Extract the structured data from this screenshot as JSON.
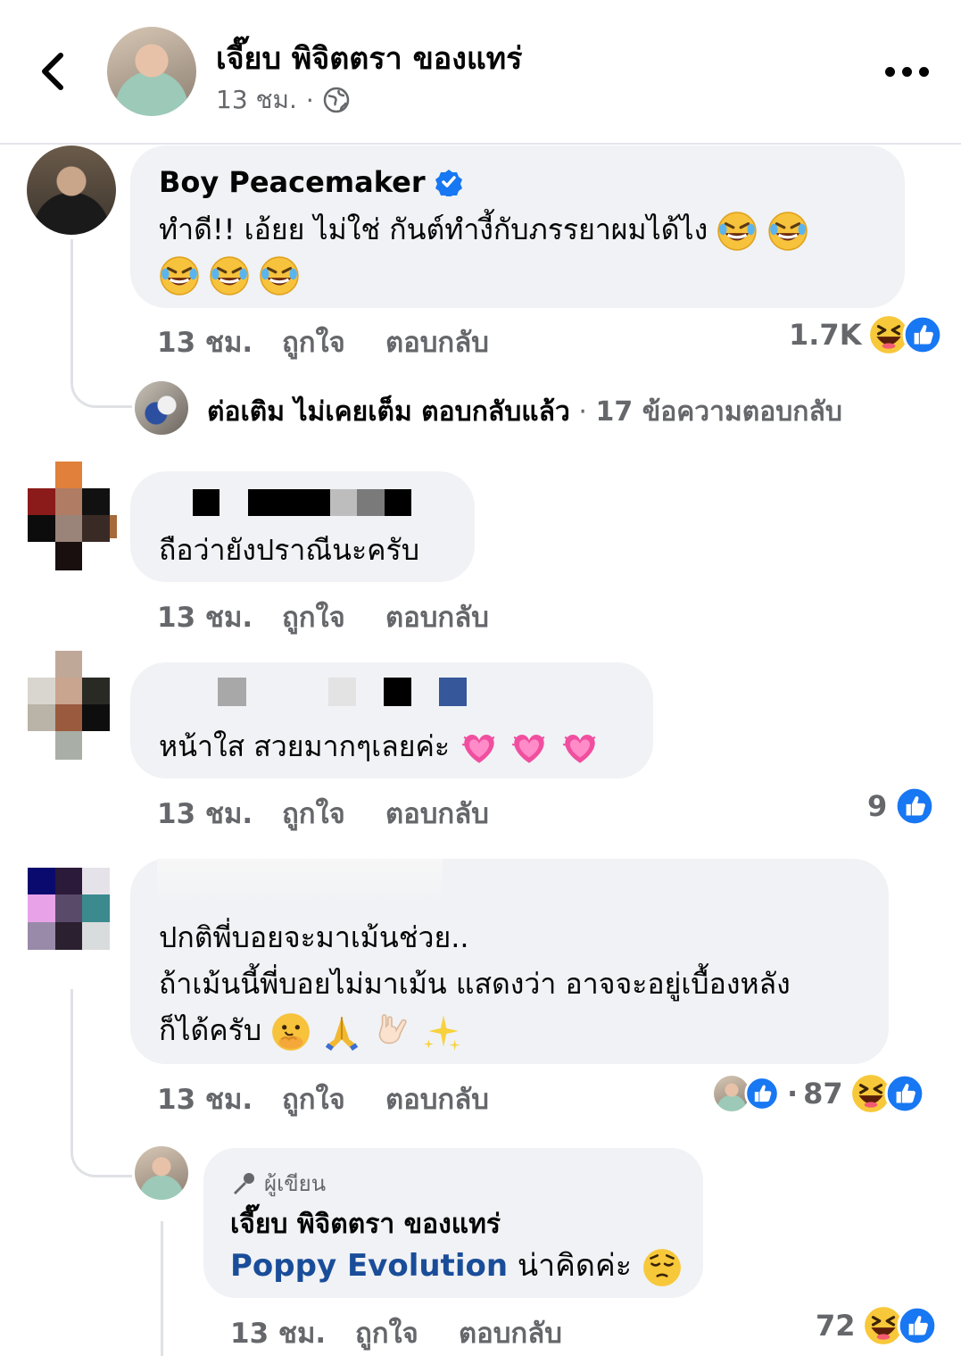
{
  "header": {
    "page_name": "เจี๊ยบ พิจิตตรา ของแทร่",
    "time": "13 ชม.",
    "dot": "·",
    "icons": {
      "back": "chevron-left-icon",
      "privacy": "globe-icon",
      "more": "more-dots-icon"
    }
  },
  "comments": [
    {
      "author": "Boy Peacemaker",
      "verified": true,
      "text_line1": "ทำดี!! เอ้ยย ไม่ใช่ กันต์ทำงี้กับภรรยาผมได้ไง",
      "time": "13 ชม.",
      "like_label": "ถูกใจ",
      "reply_label": "ตอบกลับ",
      "reaction_count": "1.7K",
      "reactions": [
        "haha",
        "like"
      ],
      "reply_summary": {
        "name": "ต่อเติม ไม่เคยเต็ม ตอบกลับแล้ว",
        "dot": "·",
        "count": "17 ข้อความตอบกลับ"
      }
    },
    {
      "text": "ถือว่ายังปราณีนะครับ",
      "time": "13 ชม.",
      "like_label": "ถูกใจ",
      "reply_label": "ตอบกลับ"
    },
    {
      "text": "หน้าใส สวยมากๆเลยค่ะ",
      "time": "13 ชม.",
      "like_label": "ถูกใจ",
      "reply_label": "ตอบกลับ",
      "reaction_count": "9",
      "reactions": [
        "like"
      ]
    },
    {
      "line1": "ปกติพี่บอยจะมาเม้นช่วย..",
      "line2": "ถ้าเม้นนี้พี่บอยไม่มาเม้น แสดงว่า อาจจะอยู่เบื้องหลัง",
      "line3": "ก็ได้ครับ",
      "time": "13 ชม.",
      "like_label": "ถูกใจ",
      "reply_label": "ตอบกลับ",
      "reaction_dot": "·",
      "reaction_count": "87",
      "reactions": [
        "haha",
        "like"
      ],
      "reply": {
        "badge": "ผู้เขียน",
        "author": "เจี๊ยบ พิจิตตรา ของแทร่",
        "mention": "Poppy Evolution",
        "text": "น่าคิดค่ะ",
        "time": "13 ชม.",
        "like_label": "ถูกใจ",
        "reply_label": "ตอบกลับ",
        "reaction_count": "72",
        "reactions": [
          "haha",
          "like"
        ]
      }
    }
  ],
  "colors": {
    "like_blue": "#1877f2",
    "bubble": "#f0f2f5",
    "meta_gray": "#65676b",
    "mention_blue": "#1a4d99"
  }
}
